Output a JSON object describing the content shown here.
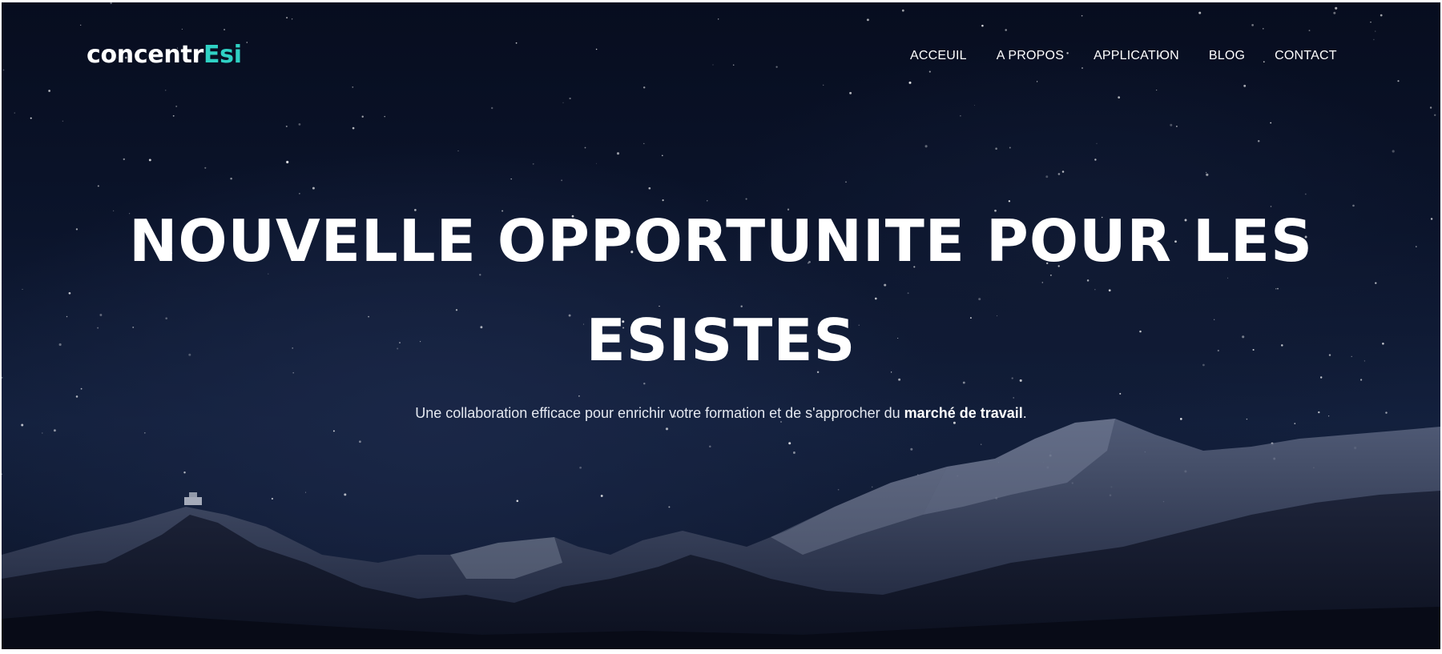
{
  "brand": {
    "name_main": "concentr",
    "name_accent": "Esi",
    "accent_color": "#2fd1c4"
  },
  "nav": {
    "items": [
      "ACCEUIL",
      "A PROPOS",
      "APPLICATION",
      "BLOG",
      "CONTACT"
    ]
  },
  "hero": {
    "title_line1": "NOUVELLE OPPORTUNITE POUR LES",
    "title_line2": "ESISTES",
    "subtitle_text": "Une collaboration efficace pour enrichir votre formation et de s'approcher du ",
    "subtitle_emphasis": "marché de travail",
    "subtitle_end": "."
  },
  "background": {
    "description_icon": "night-sky-mountains-image"
  }
}
